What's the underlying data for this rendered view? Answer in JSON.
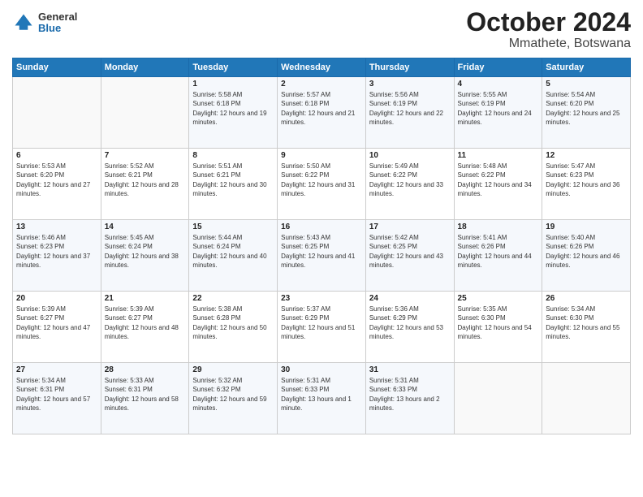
{
  "header": {
    "logo_line1": "General",
    "logo_line2": "Blue",
    "title": "October 2024",
    "subtitle": "Mmathete, Botswana"
  },
  "weekdays": [
    "Sunday",
    "Monday",
    "Tuesday",
    "Wednesday",
    "Thursday",
    "Friday",
    "Saturday"
  ],
  "weeks": [
    [
      {
        "day": "",
        "sunrise": "",
        "sunset": "",
        "daylight": ""
      },
      {
        "day": "",
        "sunrise": "",
        "sunset": "",
        "daylight": ""
      },
      {
        "day": "1",
        "sunrise": "Sunrise: 5:58 AM",
        "sunset": "Sunset: 6:18 PM",
        "daylight": "Daylight: 12 hours and 19 minutes."
      },
      {
        "day": "2",
        "sunrise": "Sunrise: 5:57 AM",
        "sunset": "Sunset: 6:18 PM",
        "daylight": "Daylight: 12 hours and 21 minutes."
      },
      {
        "day": "3",
        "sunrise": "Sunrise: 5:56 AM",
        "sunset": "Sunset: 6:19 PM",
        "daylight": "Daylight: 12 hours and 22 minutes."
      },
      {
        "day": "4",
        "sunrise": "Sunrise: 5:55 AM",
        "sunset": "Sunset: 6:19 PM",
        "daylight": "Daylight: 12 hours and 24 minutes."
      },
      {
        "day": "5",
        "sunrise": "Sunrise: 5:54 AM",
        "sunset": "Sunset: 6:20 PM",
        "daylight": "Daylight: 12 hours and 25 minutes."
      }
    ],
    [
      {
        "day": "6",
        "sunrise": "Sunrise: 5:53 AM",
        "sunset": "Sunset: 6:20 PM",
        "daylight": "Daylight: 12 hours and 27 minutes."
      },
      {
        "day": "7",
        "sunrise": "Sunrise: 5:52 AM",
        "sunset": "Sunset: 6:21 PM",
        "daylight": "Daylight: 12 hours and 28 minutes."
      },
      {
        "day": "8",
        "sunrise": "Sunrise: 5:51 AM",
        "sunset": "Sunset: 6:21 PM",
        "daylight": "Daylight: 12 hours and 30 minutes."
      },
      {
        "day": "9",
        "sunrise": "Sunrise: 5:50 AM",
        "sunset": "Sunset: 6:22 PM",
        "daylight": "Daylight: 12 hours and 31 minutes."
      },
      {
        "day": "10",
        "sunrise": "Sunrise: 5:49 AM",
        "sunset": "Sunset: 6:22 PM",
        "daylight": "Daylight: 12 hours and 33 minutes."
      },
      {
        "day": "11",
        "sunrise": "Sunrise: 5:48 AM",
        "sunset": "Sunset: 6:22 PM",
        "daylight": "Daylight: 12 hours and 34 minutes."
      },
      {
        "day": "12",
        "sunrise": "Sunrise: 5:47 AM",
        "sunset": "Sunset: 6:23 PM",
        "daylight": "Daylight: 12 hours and 36 minutes."
      }
    ],
    [
      {
        "day": "13",
        "sunrise": "Sunrise: 5:46 AM",
        "sunset": "Sunset: 6:23 PM",
        "daylight": "Daylight: 12 hours and 37 minutes."
      },
      {
        "day": "14",
        "sunrise": "Sunrise: 5:45 AM",
        "sunset": "Sunset: 6:24 PM",
        "daylight": "Daylight: 12 hours and 38 minutes."
      },
      {
        "day": "15",
        "sunrise": "Sunrise: 5:44 AM",
        "sunset": "Sunset: 6:24 PM",
        "daylight": "Daylight: 12 hours and 40 minutes."
      },
      {
        "day": "16",
        "sunrise": "Sunrise: 5:43 AM",
        "sunset": "Sunset: 6:25 PM",
        "daylight": "Daylight: 12 hours and 41 minutes."
      },
      {
        "day": "17",
        "sunrise": "Sunrise: 5:42 AM",
        "sunset": "Sunset: 6:25 PM",
        "daylight": "Daylight: 12 hours and 43 minutes."
      },
      {
        "day": "18",
        "sunrise": "Sunrise: 5:41 AM",
        "sunset": "Sunset: 6:26 PM",
        "daylight": "Daylight: 12 hours and 44 minutes."
      },
      {
        "day": "19",
        "sunrise": "Sunrise: 5:40 AM",
        "sunset": "Sunset: 6:26 PM",
        "daylight": "Daylight: 12 hours and 46 minutes."
      }
    ],
    [
      {
        "day": "20",
        "sunrise": "Sunrise: 5:39 AM",
        "sunset": "Sunset: 6:27 PM",
        "daylight": "Daylight: 12 hours and 47 minutes."
      },
      {
        "day": "21",
        "sunrise": "Sunrise: 5:39 AM",
        "sunset": "Sunset: 6:27 PM",
        "daylight": "Daylight: 12 hours and 48 minutes."
      },
      {
        "day": "22",
        "sunrise": "Sunrise: 5:38 AM",
        "sunset": "Sunset: 6:28 PM",
        "daylight": "Daylight: 12 hours and 50 minutes."
      },
      {
        "day": "23",
        "sunrise": "Sunrise: 5:37 AM",
        "sunset": "Sunset: 6:29 PM",
        "daylight": "Daylight: 12 hours and 51 minutes."
      },
      {
        "day": "24",
        "sunrise": "Sunrise: 5:36 AM",
        "sunset": "Sunset: 6:29 PM",
        "daylight": "Daylight: 12 hours and 53 minutes."
      },
      {
        "day": "25",
        "sunrise": "Sunrise: 5:35 AM",
        "sunset": "Sunset: 6:30 PM",
        "daylight": "Daylight: 12 hours and 54 minutes."
      },
      {
        "day": "26",
        "sunrise": "Sunrise: 5:34 AM",
        "sunset": "Sunset: 6:30 PM",
        "daylight": "Daylight: 12 hours and 55 minutes."
      }
    ],
    [
      {
        "day": "27",
        "sunrise": "Sunrise: 5:34 AM",
        "sunset": "Sunset: 6:31 PM",
        "daylight": "Daylight: 12 hours and 57 minutes."
      },
      {
        "day": "28",
        "sunrise": "Sunrise: 5:33 AM",
        "sunset": "Sunset: 6:31 PM",
        "daylight": "Daylight: 12 hours and 58 minutes."
      },
      {
        "day": "29",
        "sunrise": "Sunrise: 5:32 AM",
        "sunset": "Sunset: 6:32 PM",
        "daylight": "Daylight: 12 hours and 59 minutes."
      },
      {
        "day": "30",
        "sunrise": "Sunrise: 5:31 AM",
        "sunset": "Sunset: 6:33 PM",
        "daylight": "Daylight: 13 hours and 1 minute."
      },
      {
        "day": "31",
        "sunrise": "Sunrise: 5:31 AM",
        "sunset": "Sunset: 6:33 PM",
        "daylight": "Daylight: 13 hours and 2 minutes."
      },
      {
        "day": "",
        "sunrise": "",
        "sunset": "",
        "daylight": ""
      },
      {
        "day": "",
        "sunrise": "",
        "sunset": "",
        "daylight": ""
      }
    ]
  ]
}
